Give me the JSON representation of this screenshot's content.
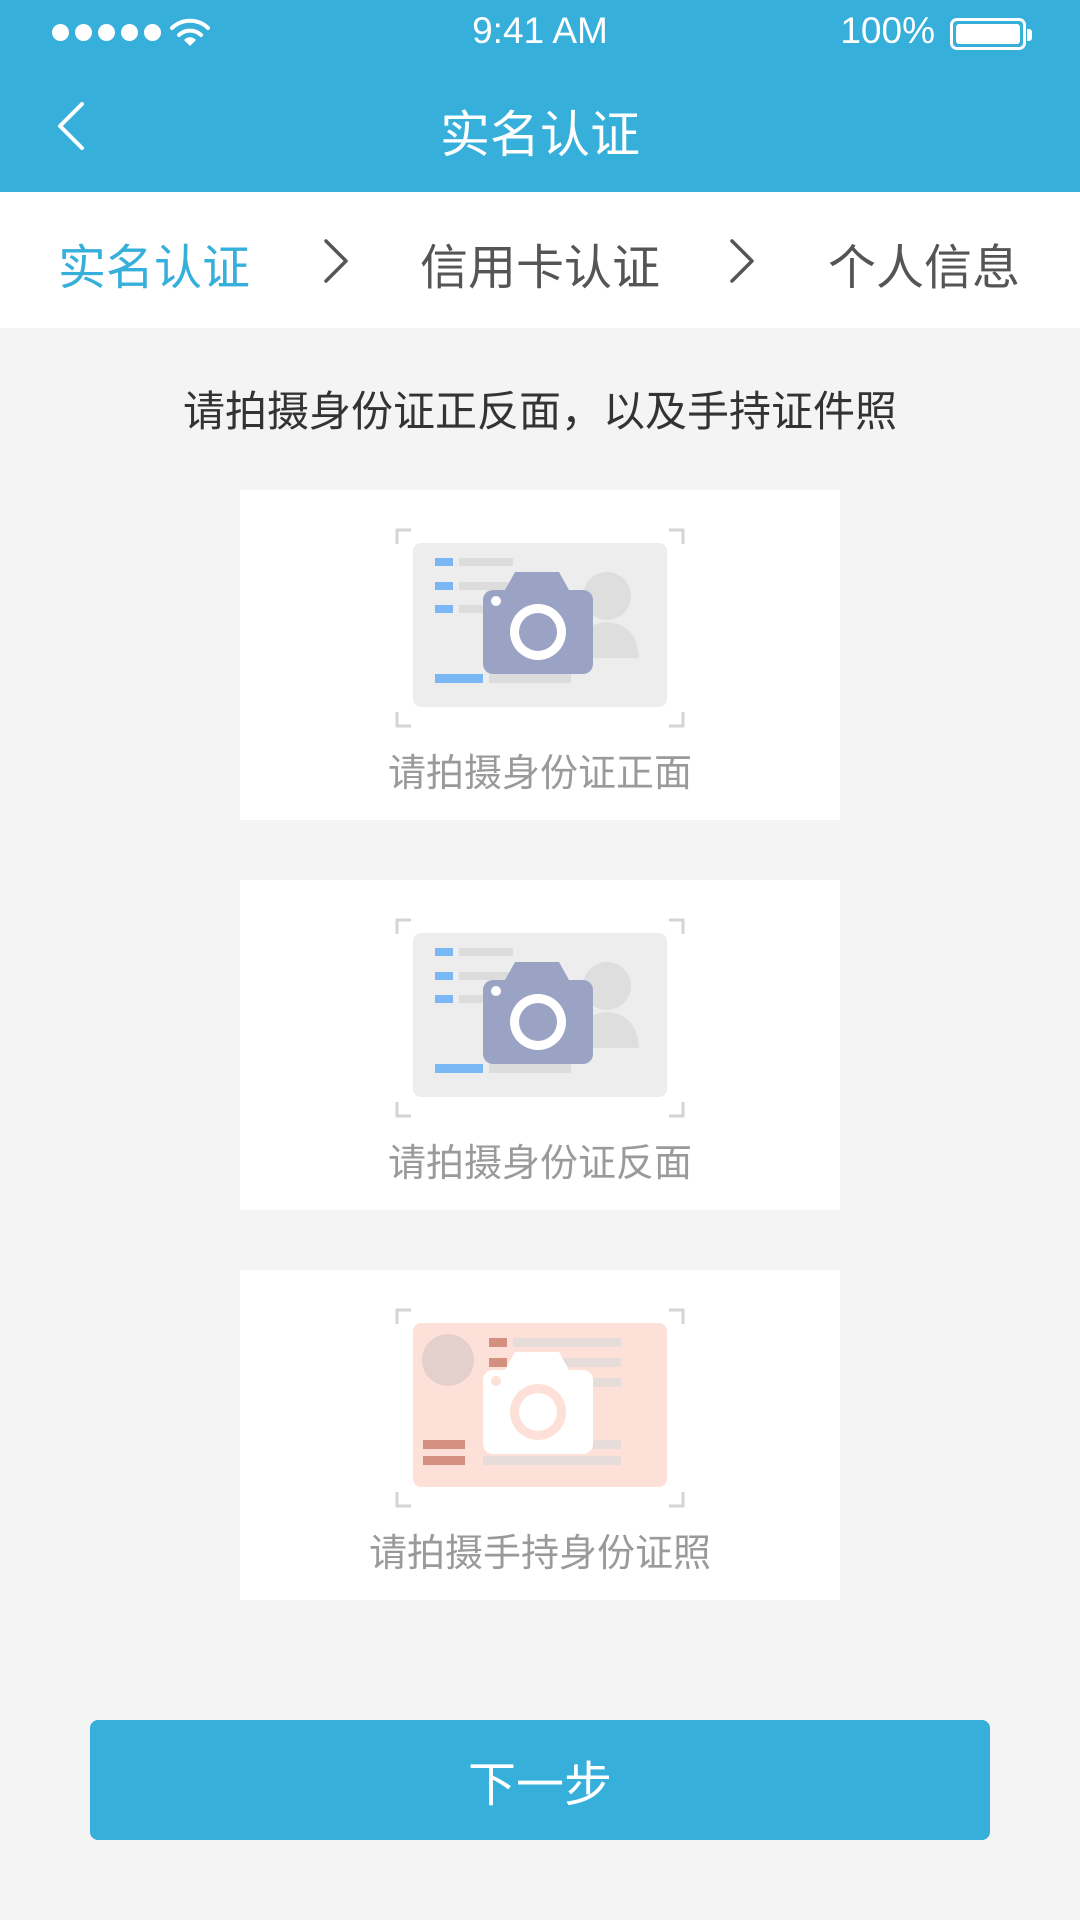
{
  "status_bar": {
    "time": "9:41 AM",
    "battery": "100%"
  },
  "nav": {
    "title": "实名认证"
  },
  "steps": [
    {
      "label": "实名认证"
    },
    {
      "label": "信用卡认证"
    },
    {
      "label": "个人信息"
    }
  ],
  "instruction": "请拍摄身份证正反面，以及手持证件照",
  "cards": [
    {
      "label": "请拍摄身份证正面"
    },
    {
      "label": "请拍摄身份证反面"
    },
    {
      "label": "请拍摄手持身份证照"
    }
  ],
  "next_button": {
    "label": "下一步"
  },
  "colors": {
    "primary": "#37afdb",
    "background": "#f4f4f4",
    "camera": "#9aa3c4",
    "id_card_pink": "#fde0d8"
  }
}
